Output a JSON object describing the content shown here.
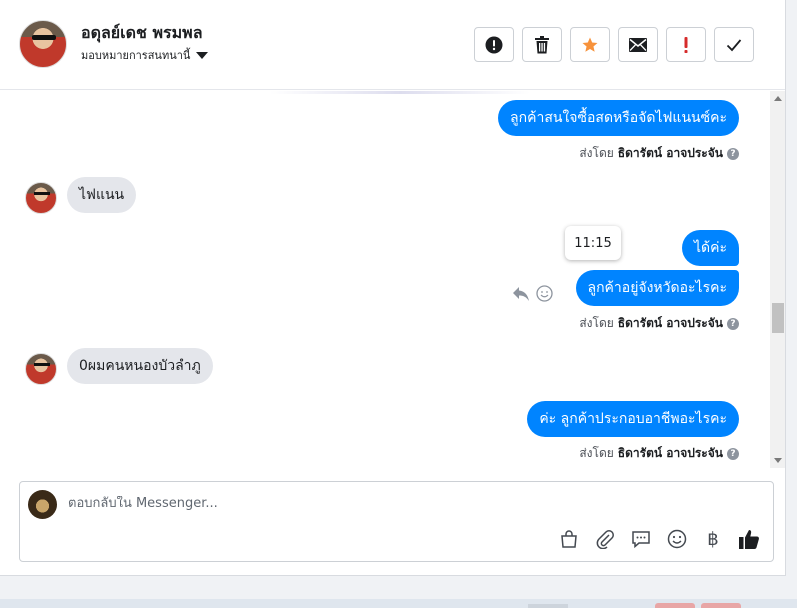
{
  "header": {
    "contact_name": "อดุลย์เดช พรมพล",
    "assign_label": "มอบหมายการสนทนานี้",
    "actions": [
      {
        "name": "spam-button",
        "icon": "exclamation-circle-icon"
      },
      {
        "name": "delete-button",
        "icon": "trash-icon"
      },
      {
        "name": "star-button",
        "icon": "star-icon",
        "color": "#f7923b"
      },
      {
        "name": "email-button",
        "icon": "envelope-icon"
      },
      {
        "name": "important-button",
        "icon": "exclamation-icon",
        "color": "#d62b2b"
      },
      {
        "name": "done-button",
        "icon": "checkmark-icon"
      }
    ]
  },
  "messages": [
    {
      "id": "m1",
      "direction": "out",
      "text": "ลูกค้าสนใจซื้อสดหรือจัดไฟแนนซ์คะ"
    },
    {
      "id": "m1s",
      "type": "sent_by",
      "prefix": "ส่งโดย",
      "agent": "ธิดารัตน์ อาจประจัน"
    },
    {
      "id": "m2",
      "direction": "in",
      "text": "ไฟแนน"
    },
    {
      "id": "m3",
      "direction": "out",
      "text": "ได้ค่ะ"
    },
    {
      "id": "m4",
      "direction": "out",
      "text": "ลูกค้าอยู่จังหวัดอะไรคะ"
    },
    {
      "id": "m4s",
      "type": "sent_by",
      "prefix": "ส่งโดย",
      "agent": "ธิดารัตน์ อาจประจัน"
    },
    {
      "id": "m5",
      "direction": "in",
      "text": "0ผมคนหนองบัวลำภู"
    },
    {
      "id": "m6",
      "direction": "out",
      "text": "ค่ะ ลูกค้าประกอบอาชีพอะไรคะ"
    },
    {
      "id": "m6s",
      "type": "sent_by",
      "prefix": "ส่งโดย",
      "agent": "ธิดารัตน์ อาจประจัน"
    }
  ],
  "tooltip_time": "11:15",
  "composer": {
    "placeholder": "ตอบกลับใน Messenger...",
    "currency_symbol": "฿",
    "icons": [
      "gift-bag-icon",
      "paperclip-icon",
      "saved-reply-icon",
      "emoji-icon",
      "baht-icon",
      "thumbs-up-icon"
    ]
  },
  "colors": {
    "outgoing_bubble": "#0084ff",
    "incoming_bubble": "#e4e6eb"
  }
}
